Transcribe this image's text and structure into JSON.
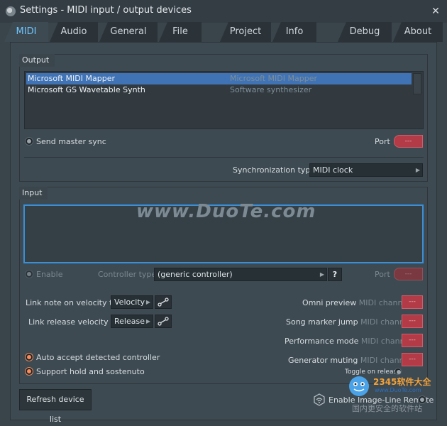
{
  "window": {
    "title": "Settings - MIDI input / output devices"
  },
  "tabs": [
    {
      "label": "MIDI",
      "active": true
    },
    {
      "label": "Audio"
    },
    {
      "label": "General"
    },
    {
      "label": "File"
    },
    {
      "label": "Project"
    },
    {
      "label": "Info"
    },
    {
      "label": "Debug"
    },
    {
      "label": "About"
    }
  ],
  "output": {
    "label": "Output",
    "devices": [
      {
        "name": "Microsoft MIDI Mapper",
        "description": "Microsoft MIDI Mapper"
      },
      {
        "name": "Microsoft GS Wavetable Synth",
        "description": "Software synthesizer"
      }
    ],
    "send_master_sync": "Send master sync",
    "port_label": "Port",
    "port_value": "---",
    "sync_type_label": "Synchronization type",
    "sync_type_value": "MIDI clock"
  },
  "input": {
    "label": "Input",
    "enable_label": "Enable",
    "controller_type_label": "Controller type",
    "controller_type_value": "(generic controller)",
    "help": "?",
    "port_label": "Port",
    "port_value": "---",
    "link_note_label": "Link note on velocity to",
    "link_note_value": "Velocity",
    "link_release_label": "Link release velocity to",
    "link_release_value": "Release",
    "omni_preview": "Omni preview",
    "song_marker_jump": "Song marker jump",
    "performance_mode": "Performance mode",
    "generator_muting": "Generator muting",
    "midi_channel": "MIDI channel",
    "channel_value": "---",
    "toggle_on_release": "Toggle on release",
    "auto_accept": "Auto accept detected controller",
    "support_hold": "Support hold and sostenuto"
  },
  "footer": {
    "refresh": "Refresh device list",
    "enable_remote": "Enable Image-Line Remote"
  },
  "watermark": {
    "site": "www.DuoTe.com",
    "brand": "2345软件大全",
    "url": "www.DuoTe.com",
    "slogan": "国内更安全的软件站"
  },
  "colors": {
    "accent_blue": "#3b8fd6",
    "selection": "#3f73b5",
    "port_red": "#b23b47",
    "radio_orange": "#ff8a55"
  }
}
